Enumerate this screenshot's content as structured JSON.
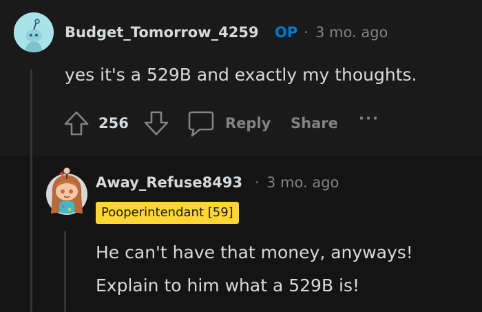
{
  "comments": [
    {
      "author": "Budget_Tomorrow_4259",
      "op_badge": "OP",
      "separator": "·",
      "time": "3 mo. ago",
      "body": "yes it's a 529B and exactly my thoughts.",
      "votes": "256",
      "actions": {
        "reply": "Reply",
        "share": "Share",
        "more": "···"
      },
      "avatar_icon": "snoo-avatar-icon"
    },
    {
      "author": "Away_Refuse8493",
      "separator": "·",
      "time": "3 mo. ago",
      "flair": "Pooperintendant [59]",
      "body_lines": [
        "He can't have that money, anyways!",
        "Explain to him what a 529B is!"
      ],
      "avatar_icon": "girl-snoo-avatar-icon"
    }
  ],
  "colors": {
    "background": "#1a1a1b",
    "nested_background": "#141415",
    "text": "#d7dadc",
    "muted": "#818384",
    "op": "#0079d3",
    "flair_bg": "#ffd635"
  }
}
